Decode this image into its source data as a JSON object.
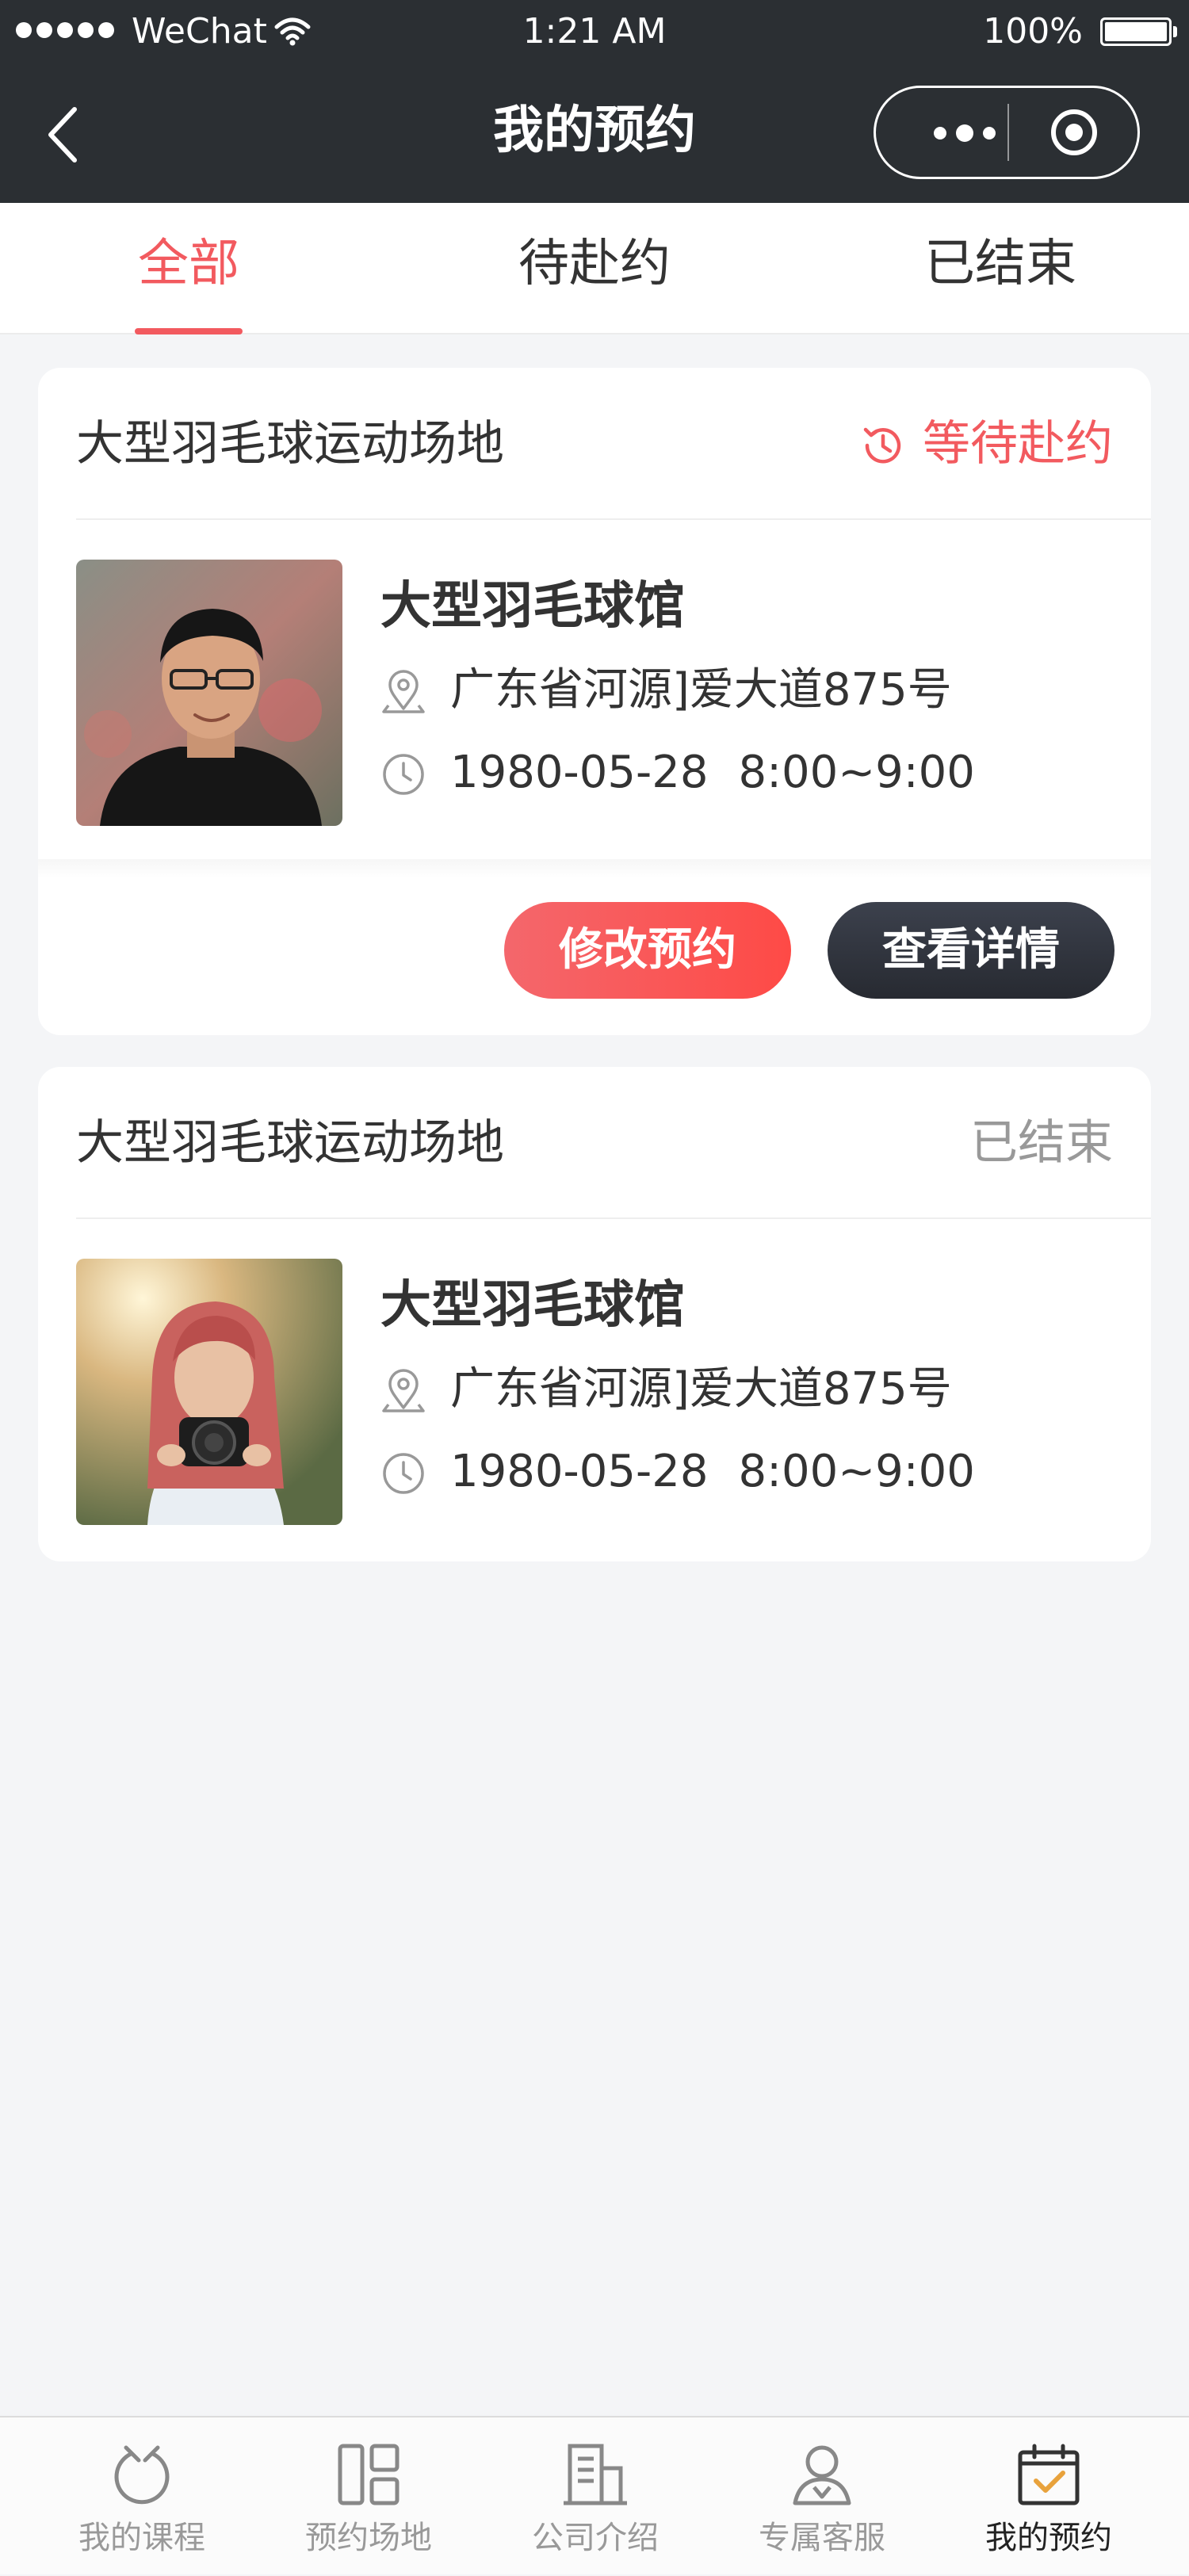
{
  "status_bar": {
    "carrier": "WeChat",
    "time": "1:21 AM",
    "battery": "100%"
  },
  "nav": {
    "title": "我的预约"
  },
  "tabs": [
    {
      "label": "全部",
      "active": true
    },
    {
      "label": "待赴约",
      "active": false
    },
    {
      "label": "已结束",
      "active": false
    }
  ],
  "bookings": [
    {
      "venue": "大型羽毛球运动场地",
      "status": "等待赴约",
      "hall": "大型羽毛球馆",
      "address": "广东省河源]爱大道875号",
      "date": "1980-05-28",
      "time": "8:00~9:00",
      "actions": {
        "modify": "修改预约",
        "detail": "查看详情"
      }
    },
    {
      "venue": "大型羽毛球运动场地",
      "status": "已结束",
      "hall": "大型羽毛球馆",
      "address": "广东省河源]爱大道875号",
      "date": "1980-05-28",
      "time": "8:00~9:00"
    }
  ],
  "tabbar": [
    {
      "label": "我的课程",
      "icon": "courses-icon",
      "active": false
    },
    {
      "label": "预约场地",
      "icon": "venue-grid-icon",
      "active": false
    },
    {
      "label": "公司介绍",
      "icon": "company-building-icon",
      "active": false
    },
    {
      "label": "专属客服",
      "icon": "service-person-icon",
      "active": false
    },
    {
      "label": "我的预约",
      "icon": "calendar-check-icon",
      "active": true
    }
  ],
  "colors": {
    "accent": "#f25a5f",
    "nav_background": "#2b2f33",
    "dark_button": "#2f333b",
    "ended_gray": "#999999"
  }
}
